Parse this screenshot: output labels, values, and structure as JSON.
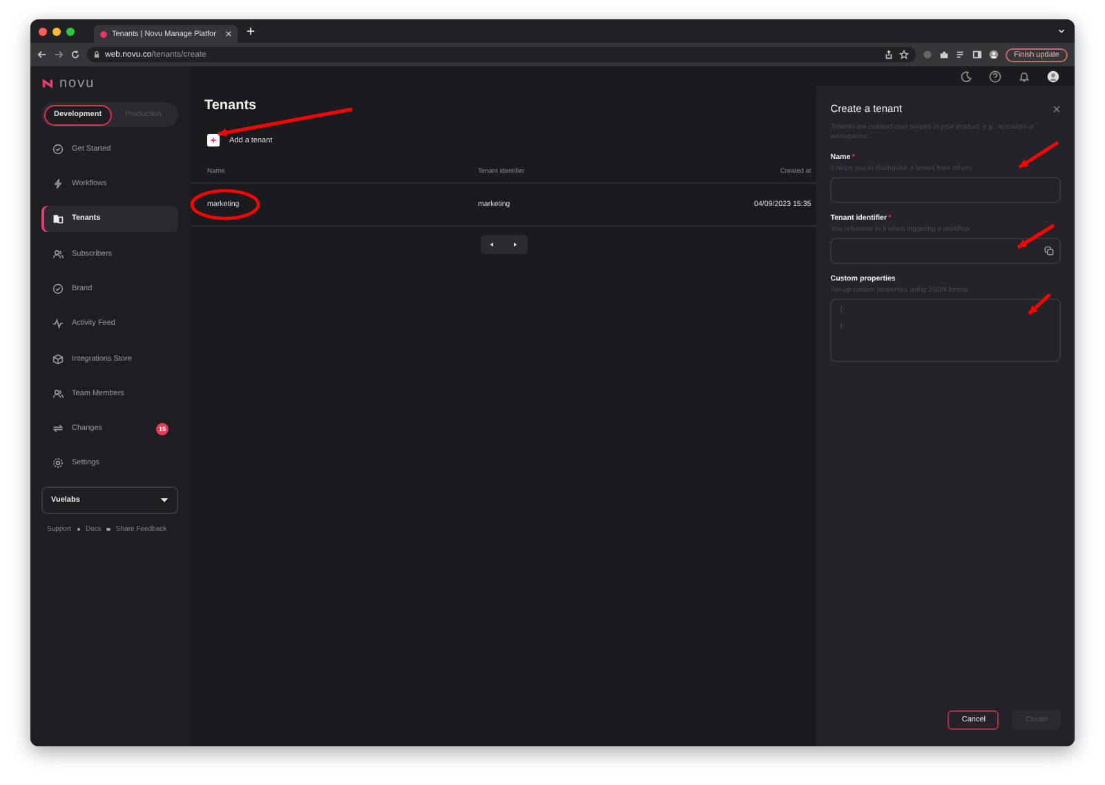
{
  "browser": {
    "tab_title": "Tenants | Novu Manage Platfor",
    "url_host": "web.novu.co",
    "url_path": "/tenants/create",
    "finish_update": "Finish update"
  },
  "sidebar": {
    "logo": "novu",
    "environments": [
      {
        "label": "Development",
        "selected": true
      },
      {
        "label": "Production",
        "selected": false
      }
    ],
    "items": [
      {
        "label": "Get Started",
        "selected": false
      },
      {
        "label": "Workflows",
        "selected": false
      },
      {
        "label": "Tenants",
        "selected": true
      },
      {
        "label": "Subscribers",
        "selected": false
      },
      {
        "label": "Brand",
        "selected": false
      },
      {
        "label": "Activity Feed",
        "selected": false
      },
      {
        "label": "Integrations Store",
        "selected": false
      },
      {
        "label": "Team Members",
        "selected": false
      },
      {
        "label": "Changes",
        "selected": false,
        "badge": "15"
      },
      {
        "label": "Settings",
        "selected": false
      }
    ],
    "organization": "Vuelabs",
    "footer_links": [
      "Support",
      "Docs",
      "Share Feedback"
    ]
  },
  "main": {
    "title": "Tenants",
    "add_button": "Add a tenant",
    "table": {
      "columns": [
        "Name",
        "Tenant identifier",
        "Created at"
      ],
      "rows": [
        [
          "marketing",
          "marketing",
          "04/09/2023 15:35"
        ]
      ]
    }
  },
  "drawer": {
    "title": "Create a tenant",
    "description": "Tenants are isolated user scopes in your product, e.g., accounts or workspaces.",
    "fields": [
      {
        "kind": "text",
        "label": "Name",
        "required": true,
        "required_mark": "*",
        "hint": "It helps you to distinguish a tenant from others"
      },
      {
        "kind": "copy",
        "label": "Tenant identifier",
        "required": true,
        "required_mark": "*",
        "hint": "You reference to it when triggering a workflow"
      },
      {
        "kind": "code",
        "label": "Custom properties",
        "required": false,
        "hint": "Set-up custom properties using JSON format",
        "lines": [
          "{",
          "}"
        ]
      }
    ],
    "buttons": [
      {
        "label": "Cancel",
        "kind": "secondary",
        "disabled": false
      },
      {
        "label": "Create",
        "kind": "primary",
        "disabled": true
      }
    ]
  }
}
